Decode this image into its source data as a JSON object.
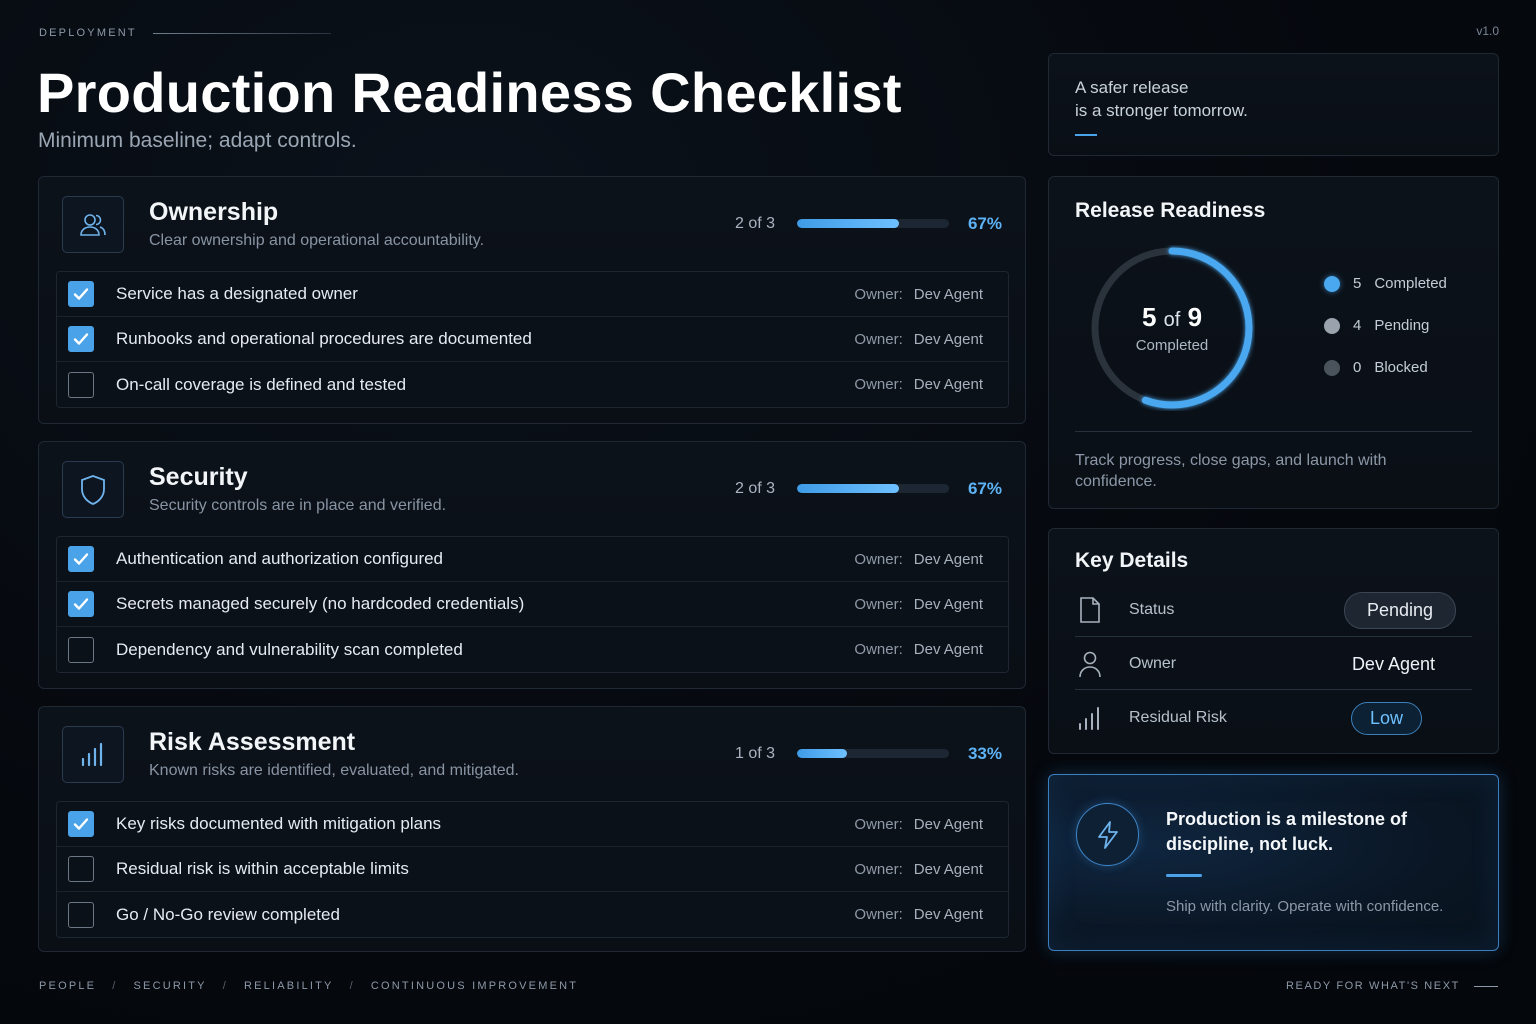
{
  "header": {
    "eyebrow": "DEPLOYMENT",
    "version": "v1.0",
    "title": "Production Readiness Checklist",
    "subtitle": "Minimum baseline; adapt controls."
  },
  "sections": [
    {
      "icon": "people-icon",
      "title": "Ownership",
      "description": "Clear ownership and operational accountability.",
      "count": "2 of 3",
      "percent": "67%",
      "progress": 0.67,
      "items": [
        {
          "label": "Service has a designated owner",
          "checked": true,
          "owner_label": "Owner:",
          "owner": "Dev Agent"
        },
        {
          "label": "Runbooks and operational procedures are documented",
          "checked": true,
          "owner_label": "Owner:",
          "owner": "Dev Agent"
        },
        {
          "label": "On-call coverage is defined and tested",
          "checked": false,
          "owner_label": "Owner:",
          "owner": "Dev Agent"
        }
      ]
    },
    {
      "icon": "shield-icon",
      "title": "Security",
      "description": "Security controls are in place and verified.",
      "count": "2 of 3",
      "percent": "67%",
      "progress": 0.67,
      "items": [
        {
          "label": "Authentication and authorization configured",
          "checked": true,
          "owner_label": "Owner:",
          "owner": "Dev Agent"
        },
        {
          "label": "Secrets managed securely (no hardcoded credentials)",
          "checked": true,
          "owner_label": "Owner:",
          "owner": "Dev Agent"
        },
        {
          "label": "Dependency and vulnerability scan completed",
          "checked": false,
          "owner_label": "Owner:",
          "owner": "Dev Agent"
        }
      ]
    },
    {
      "icon": "bar-chart-icon",
      "title": "Risk Assessment",
      "description": "Known risks are identified, evaluated, and mitigated.",
      "count": "1 of 3",
      "percent": "33%",
      "progress": 0.33,
      "items": [
        {
          "label": "Key risks documented with mitigation plans",
          "checked": true,
          "owner_label": "Owner:",
          "owner": "Dev Agent"
        },
        {
          "label": "Residual risk is within acceptable limits",
          "checked": false,
          "owner_label": "Owner:",
          "owner": "Dev Agent"
        },
        {
          "label": "Go / No-Go review completed",
          "checked": false,
          "owner_label": "Owner:",
          "owner": "Dev Agent"
        }
      ]
    }
  ],
  "quote": {
    "line1": "A safer release",
    "line2": "is a stronger tomorrow."
  },
  "readiness": {
    "title": "Release Readiness",
    "completed": "5",
    "of_text": "of",
    "total": "9",
    "center_label": "Completed",
    "progress": 0.556,
    "legend": [
      {
        "count": "5",
        "label": "Completed",
        "color": "#4aa8f0"
      },
      {
        "count": "4",
        "label": "Pending",
        "color": "#9aa3ad"
      },
      {
        "count": "0",
        "label": "Blocked",
        "color": "#4a525c"
      }
    ],
    "footer": "Track progress, close gaps, and launch with confidence."
  },
  "key_details": {
    "title": "Key Details",
    "status_label": "Status",
    "status_value": "Pending",
    "owner_label": "Owner",
    "owner_value": "Dev Agent",
    "risk_label": "Residual Risk",
    "risk_value": "Low"
  },
  "cta": {
    "title": "Production is a milestone of discipline, not luck.",
    "subtitle": "Ship with clarity. Operate with confidence."
  },
  "footer": {
    "tags": [
      "PEOPLE",
      "SECURITY",
      "RELIABILITY",
      "CONTINUOUS IMPROVEMENT"
    ],
    "separator": "/",
    "right": "READY FOR WHAT'S NEXT"
  },
  "colors": {
    "accent": "#4aa3e8",
    "background": "#05080d"
  }
}
